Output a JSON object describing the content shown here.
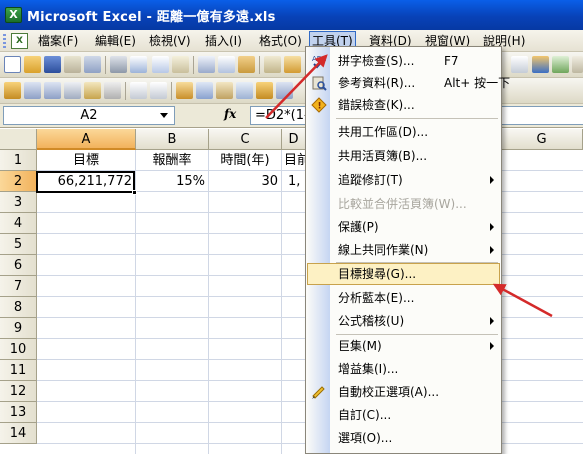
{
  "window": {
    "title": "Microsoft Excel - 距離一億有多遠.xls",
    "app_icon": "X"
  },
  "menu": [
    "檔案(F)",
    "編輯(E)",
    "檢視(V)",
    "插入(I)",
    "格式(O)",
    "工具(T)",
    "資料(D)",
    "視窗(W)",
    "說明(H)"
  ],
  "formula_bar": {
    "name_box": "A2",
    "fx": "fx",
    "formula": "=D2*(1-"
  },
  "sheet": {
    "columns": [
      "A",
      "B",
      "C",
      "D",
      "G"
    ],
    "rows": [
      "1",
      "2",
      "3",
      "4",
      "5",
      "6",
      "7",
      "8",
      "9",
      "10",
      "11",
      "12",
      "13",
      "14"
    ],
    "row1": [
      "目標",
      "報酬率",
      "時間(年)",
      "目前"
    ],
    "row2": [
      "66,211,772",
      "15%",
      "30",
      "1,"
    ]
  },
  "tools_menu": {
    "items": [
      {
        "label": "拼字檢查(S)...",
        "shortcut": "F7",
        "icon": "spelling-icon"
      },
      {
        "label": "參考資料(R)...",
        "shortcut": "Alt+ 按一下",
        "icon": "research-icon"
      },
      {
        "label": "錯誤檢查(K)...",
        "icon": "error-check-icon"
      },
      {
        "label": "共用工作區(D)..."
      },
      {
        "label": "共用活頁簿(B)..."
      },
      {
        "label": "追蹤修訂(T)",
        "submenu": true
      },
      {
        "label": "比較並合併活頁簿(W)...",
        "disabled": true
      },
      {
        "label": "保護(P)",
        "submenu": true
      },
      {
        "label": "線上共同作業(N)",
        "submenu": true
      },
      {
        "label": "目標搜尋(G)...",
        "highlighted": true
      },
      {
        "label": "分析藍本(E)..."
      },
      {
        "label": "公式稽核(U)",
        "submenu": true
      },
      {
        "label": "巨集(M)",
        "submenu": true
      },
      {
        "label": "增益集(I)..."
      },
      {
        "label": "自動校正選項(A)...",
        "icon": "autocorrect-icon"
      },
      {
        "label": "自訂(C)..."
      },
      {
        "label": "選項(O)..."
      }
    ]
  },
  "colors": {
    "title_bar": "#0842b8",
    "arrow": "#d42a2a",
    "highlight": "#fdf1c4"
  }
}
